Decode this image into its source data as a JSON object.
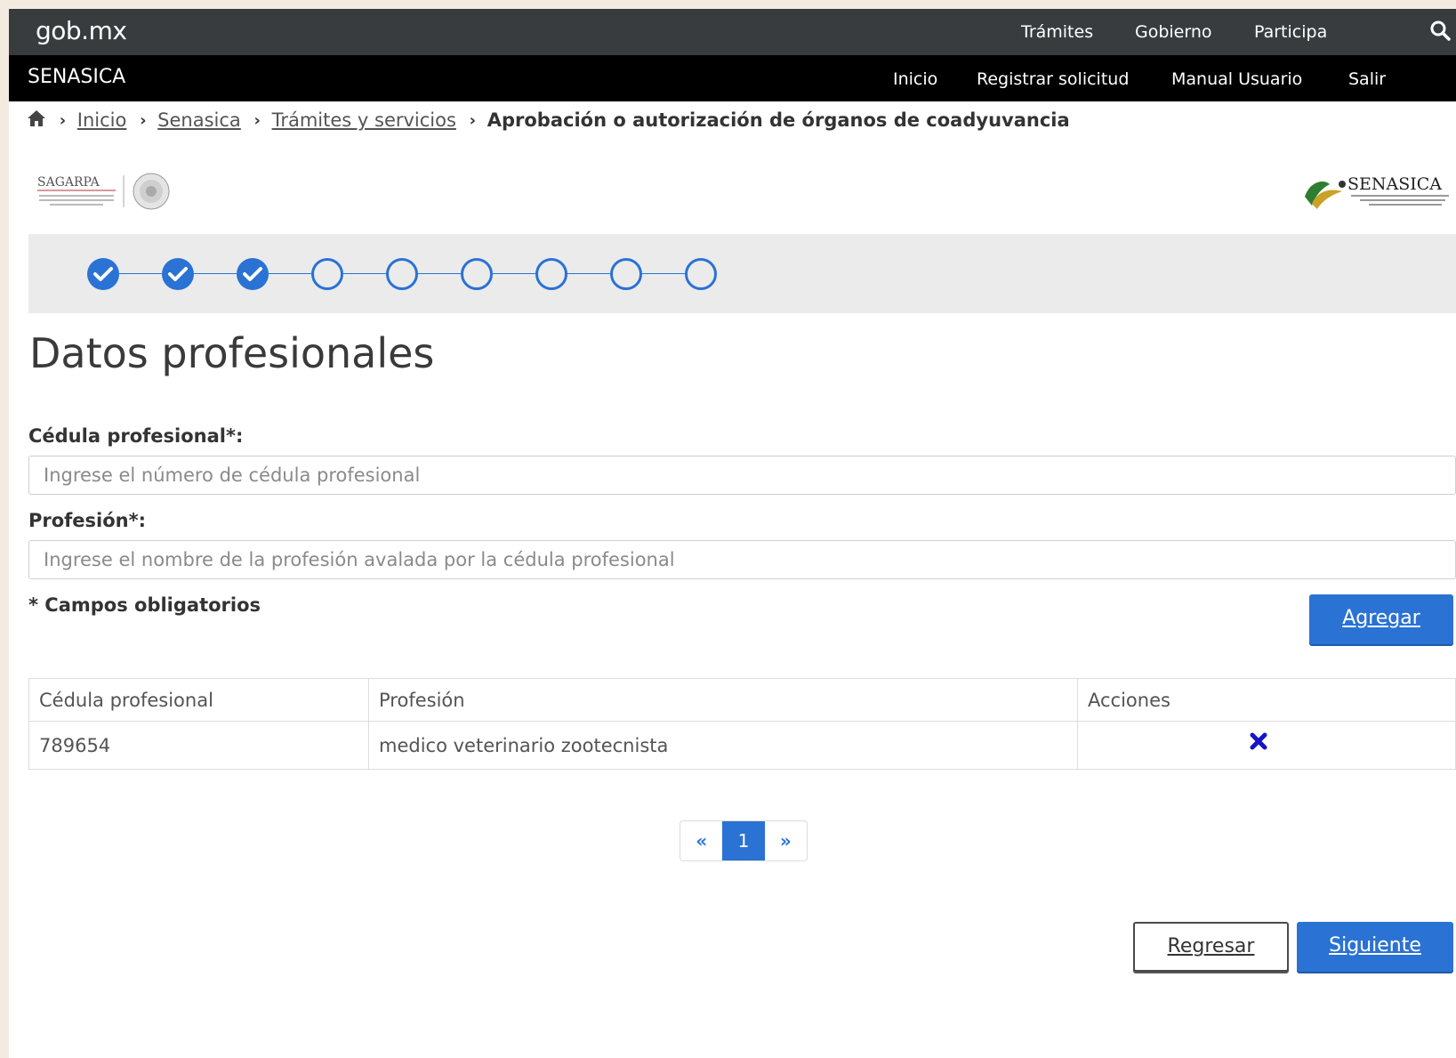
{
  "gob_bar": {
    "logo": "gob.mx",
    "links": [
      "Trámites",
      "Gobierno",
      "Participa"
    ],
    "search_icon": "search-icon"
  },
  "sub_bar": {
    "title": "SENASICA",
    "links": [
      "Inicio",
      "Registrar solicitud",
      "Manual Usuario",
      "Salir"
    ]
  },
  "breadcrumb": {
    "home_icon": "home-icon",
    "items": [
      "Inicio",
      "Senasica",
      "Trámites y servicios"
    ],
    "current": "Aprobación o autorización de órganos de coadyuvancia"
  },
  "logos": {
    "left": "SAGARPA",
    "right": "SENASICA"
  },
  "stepper": {
    "total_steps": 9,
    "completed_steps": 3,
    "check_icon": "check-icon"
  },
  "page": {
    "title": "Datos profesionales"
  },
  "form": {
    "cedula_label": "Cédula profesional*:",
    "cedula_placeholder": "Ingrese el número de cédula profesional",
    "cedula_value": "",
    "profesion_label": "Profesión*:",
    "profesion_placeholder": "Ingrese el nombre de la profesión avalada por la cédula profesional",
    "profesion_value": "",
    "required_note": "* Campos obligatorios",
    "add_button": "Agregar"
  },
  "table": {
    "headers": [
      "Cédula profesional",
      "Profesión",
      "Acciones"
    ],
    "rows": [
      {
        "cedula": "789654",
        "profesion": "medico veterinario zootecnista",
        "action_icon": "delete-icon"
      }
    ]
  },
  "pagination": {
    "prev": "«",
    "current": "1",
    "next": "»"
  },
  "actions": {
    "back": "Regresar",
    "next": "Siguiente"
  },
  "colors": {
    "primary": "#2a72d4",
    "gob_bar": "#393c3e",
    "sub_bar": "#000000",
    "delete_icon": "#1515c8"
  }
}
